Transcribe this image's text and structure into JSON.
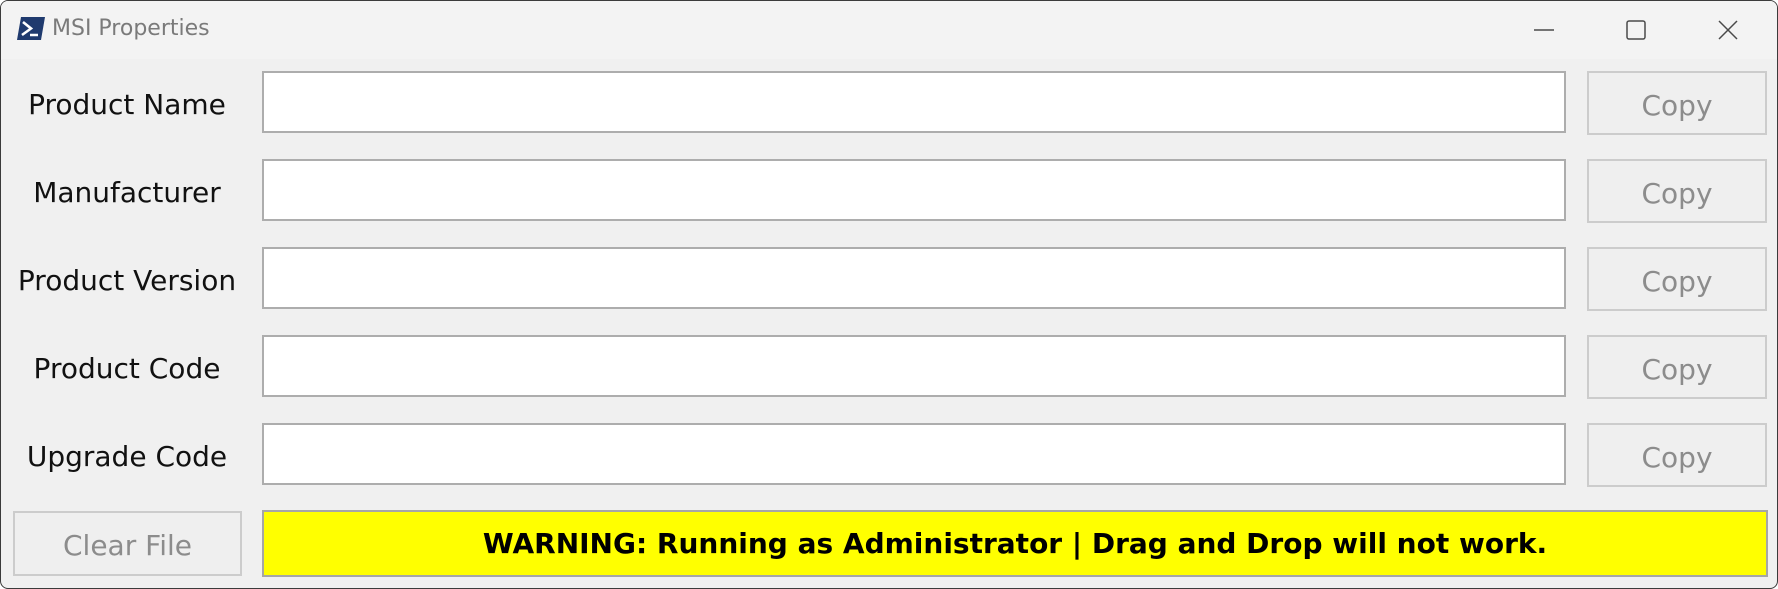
{
  "window": {
    "title": "MSI Properties",
    "icon": "powershell-icon",
    "controls": [
      "minimize-icon",
      "maximize-icon",
      "close-icon"
    ]
  },
  "fields": [
    {
      "label": "Product Name",
      "value": "",
      "copy_label": "Copy"
    },
    {
      "label": "Manufacturer",
      "value": "",
      "copy_label": "Copy"
    },
    {
      "label": "Product Version",
      "value": "",
      "copy_label": "Copy"
    },
    {
      "label": "Product Code",
      "value": "",
      "copy_label": "Copy"
    },
    {
      "label": "Upgrade Code",
      "value": "",
      "copy_label": "Copy"
    }
  ],
  "footer": {
    "clear_label": "Clear File",
    "warning_text": "WARNING: Running as Administrator | Drag and Drop will not work."
  },
  "colors": {
    "warning_background": "#ffff00",
    "window_background": "#f0f0f0",
    "disabled_text": "#8c8c8c"
  }
}
